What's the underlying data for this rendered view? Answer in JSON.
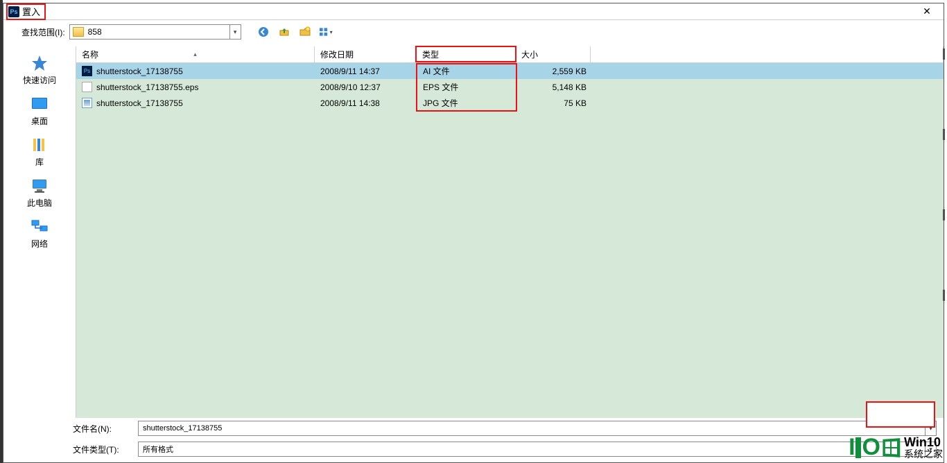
{
  "title": "置入",
  "app_icon": "Ps",
  "close_icon": "✕",
  "lookin_label": "查找范围(I):",
  "folder_name": "858",
  "toolbar_icons": [
    "back-icon",
    "up-icon",
    "new-folder-icon",
    "views-icon"
  ],
  "sidebar": [
    {
      "name": "quick-access",
      "label": "快速访问"
    },
    {
      "name": "desktop",
      "label": "桌面"
    },
    {
      "name": "libraries",
      "label": "库"
    },
    {
      "name": "this-pc",
      "label": "此电脑"
    },
    {
      "name": "network",
      "label": "网络"
    }
  ],
  "columns": {
    "name": "名称",
    "date": "修改日期",
    "type": "类型",
    "size": "大小"
  },
  "files": [
    {
      "icon": "ps",
      "name": "shutterstock_17138755",
      "date": "2008/9/11 14:37",
      "type": "AI 文件",
      "size": "2,559 KB",
      "selected": true
    },
    {
      "icon": "eps",
      "name": "shutterstock_17138755.eps",
      "date": "2008/9/10 12:37",
      "type": "EPS 文件",
      "size": "5,148 KB",
      "selected": false
    },
    {
      "icon": "jpg",
      "name": "shutterstock_17138755",
      "date": "2008/9/11 14:38",
      "type": "JPG 文件",
      "size": "75 KB",
      "selected": false
    }
  ],
  "filename_label": "文件名(N):",
  "filename_value": "shutterstock_17138755",
  "filetype_label": "文件类型(T):",
  "filetype_value": "所有格式",
  "watermark": {
    "brand": "I❙O",
    "line1": "Win10",
    "line2": "系统之家"
  }
}
